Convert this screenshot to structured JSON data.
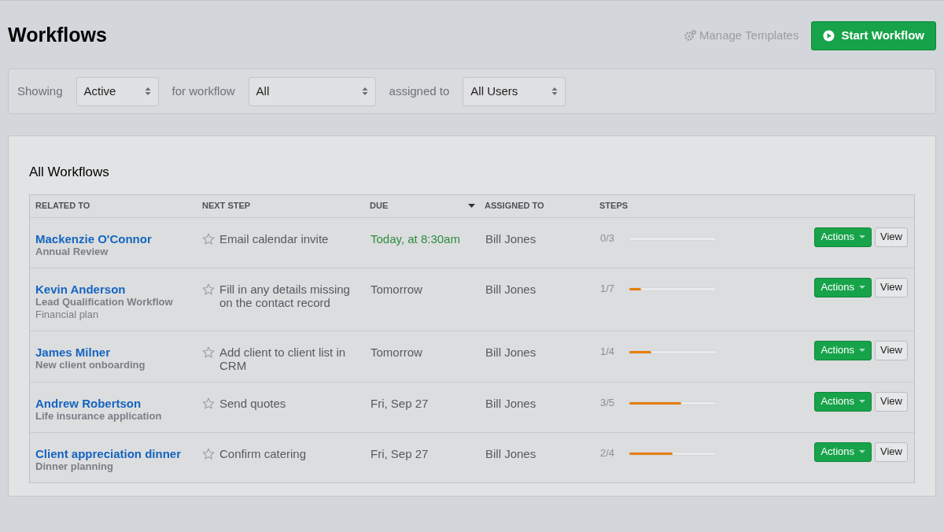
{
  "page_title": "Workflows",
  "header_actions": {
    "manage_templates": "Manage Templates",
    "start_workflow": "Start Workflow"
  },
  "filters": [
    {
      "label": "Showing",
      "value": "Active"
    },
    {
      "label": "for workflow",
      "value": "All"
    },
    {
      "label": "assigned to",
      "value": "All Users"
    }
  ],
  "panel_title": "All Workflows",
  "table": {
    "columns": [
      {
        "label": "RELATED TO",
        "sorted": false
      },
      {
        "label": "NEXT STEP",
        "sorted": false
      },
      {
        "label": "DUE",
        "sorted": true
      },
      {
        "label": "ASSIGNED TO",
        "sorted": false
      },
      {
        "label": "STEPS",
        "sorted": false
      }
    ],
    "rows": [
      {
        "name": "Mackenzie O'Connor",
        "workflow": "Annual Review",
        "note": "",
        "starred": false,
        "next_step": "Email calendar invite",
        "due": {
          "text": "Today, at 8:30am",
          "kind": "today"
        },
        "assigned": "Bill Jones",
        "steps": "0/3",
        "level": 0,
        "actions": "Actions",
        "view": "View"
      },
      {
        "name": "Kevin Anderson",
        "workflow": "Lead Qualification Workflow",
        "note": "Financial plan",
        "starred": false,
        "next_step": "Fill in any details missing on the contact record",
        "due": {
          "text": "Tomorrow",
          "kind": "normal"
        },
        "assigned": "Bill Jones",
        "steps": "1/7",
        "level": 0.14,
        "actions": "Actions",
        "view": "View"
      },
      {
        "name": "James Milner",
        "workflow": "New client onboarding",
        "note": "",
        "starred": false,
        "next_step": "Add client to client list in CRM",
        "due": {
          "text": "Tomorrow",
          "kind": "normal"
        },
        "assigned": "Bill Jones",
        "steps": "1/4",
        "level": 0.25,
        "actions": "Actions",
        "view": "View"
      },
      {
        "name": "Andrew Robertson",
        "workflow": "Life insurance application",
        "note": "",
        "starred": false,
        "next_step": "Send quotes",
        "due": {
          "text": "Fri, Sep 27",
          "kind": "normal"
        },
        "assigned": "Bill Jones",
        "steps": "3/5",
        "level": 0.6,
        "actions": "Actions",
        "view": "View"
      },
      {
        "name": "Client appreciation dinner",
        "workflow": "Dinner planning",
        "note": "",
        "starred": false,
        "next_step": "Confirm catering",
        "due": {
          "text": "Fri, Sep 27",
          "kind": "normal"
        },
        "assigned": "Bill Jones",
        "steps": "2/4",
        "level": 0.5,
        "actions": "Actions",
        "view": "View"
      }
    ]
  }
}
